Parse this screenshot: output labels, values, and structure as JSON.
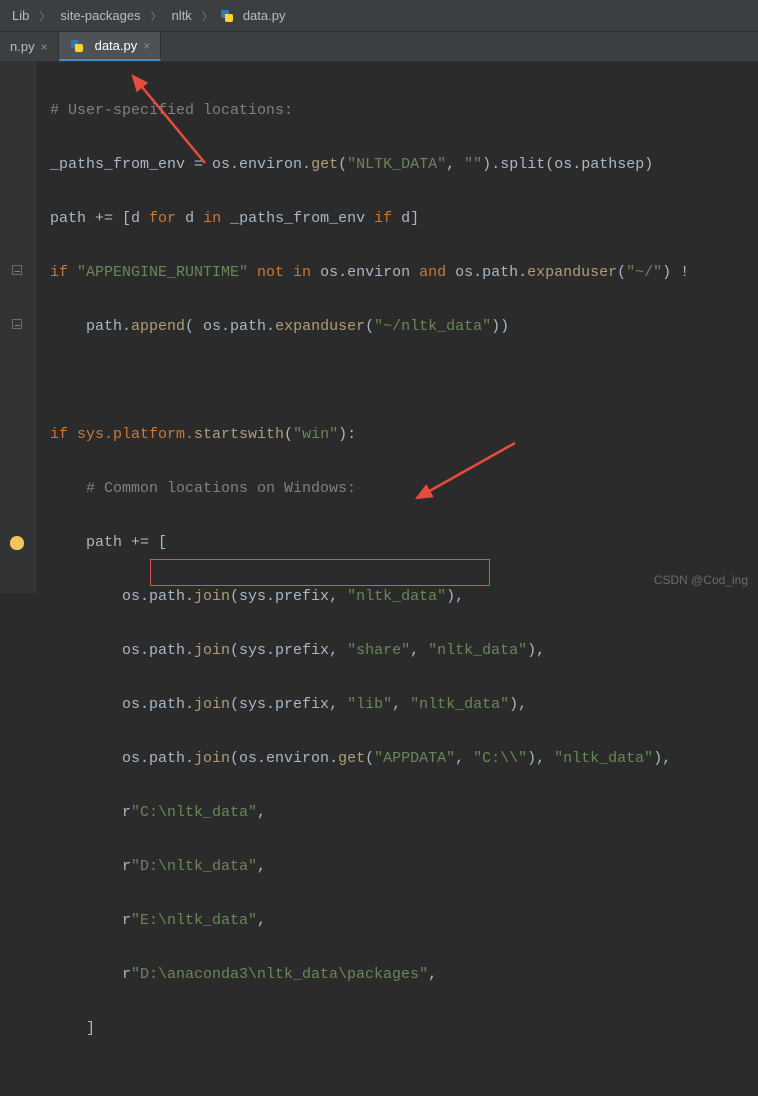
{
  "breadcrumb": {
    "items": [
      "Lib",
      "site-packages",
      "nltk",
      "data.py"
    ]
  },
  "tabs": {
    "inactive_label": "n.py",
    "active_label": "data.py"
  },
  "code": {
    "comment1": "# User-specified locations:",
    "var_paths": "_paths_from_env",
    "eq1": " = ",
    "os_env_get": "os.environ.",
    "get": "get",
    "open_paren": "(",
    "nltk_data_str": "\"NLTK_DATA\"",
    "comma": ", ",
    "empty_str": "\"\"",
    "close_paren": ")",
    "split_call": ".split(os.pathsep)",
    "path_var": "path",
    "plus_eq": " += ",
    "list_open": "[d ",
    "for_kw": "for",
    "d_in": " d ",
    "in_kw": "in",
    "paths_env": " _paths_from_env ",
    "if_kw": "if",
    "d_close": " d]",
    "if_line": "if ",
    "appengine": "\"APPENGINE_RUNTIME\"",
    "not_kw": " not in ",
    "os_environ": "os.environ ",
    "and_kw": "and",
    "expanduser_call": " os.path.",
    "expanduser": "expanduser",
    "home_str": "\"~/\"",
    "excl": ") !",
    "append_line": "    path.",
    "append": "append",
    "nltk_data_path": "\"~/nltk_data\"",
    "close2": "))",
    "sys_platform": "if sys.platform.",
    "startswith": "startswith",
    "win_str": "\"win\"",
    "close_colon": "):",
    "comment2": "    # Common locations on Windows:",
    "path_plus": "    path += [",
    "os_path_join": "        os.path.",
    "join": "join",
    "sys_prefix": "(sys.prefix, ",
    "nltk_data_s": "\"nltk_data\"",
    "close_comma": "),",
    "share_str": "\"share\"",
    "lib_str": "\"lib\"",
    "os_environ_get": "(os.environ.",
    "appdata": "\"APPDATA\"",
    "c_drive": "\"C:\\\\\"",
    "close_paren_comma": "), ",
    "r_prefix": "        r",
    "c_nltk": "\"C:\\nltk_data\"",
    "d_nltk": "\"D:\\nltk_data\"",
    "e_nltk": "\"E:\\nltk_data\"",
    "anaconda": "\"D:\\anaconda3\\nltk_data\\packages\"",
    "comma_end": ",",
    "list_close": "    ]"
  },
  "watermark": "CSDN @Cod_ing"
}
